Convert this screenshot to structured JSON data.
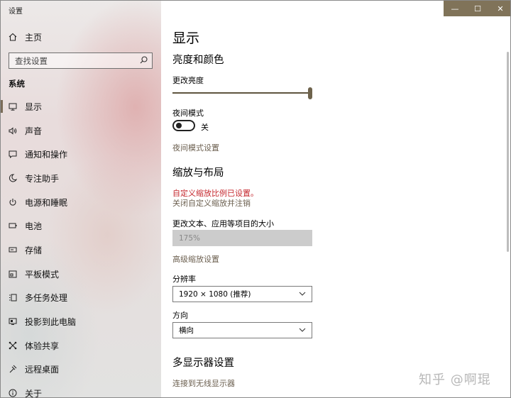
{
  "app_title": "设置",
  "window_controls": {
    "minimize": "—",
    "maximize": "☐",
    "close": "✕"
  },
  "sidebar": {
    "home": {
      "icon": "home-icon",
      "label": "主页"
    },
    "search": {
      "placeholder": "查找设置",
      "icon": "search-icon"
    },
    "section_label": "系统",
    "items": [
      {
        "icon": "monitor-icon",
        "label": "显示",
        "active": true
      },
      {
        "icon": "speaker-icon",
        "label": "声音"
      },
      {
        "icon": "notification-icon",
        "label": "通知和操作"
      },
      {
        "icon": "focus-assist-icon",
        "label": "专注助手"
      },
      {
        "icon": "power-icon",
        "label": "电源和睡眠"
      },
      {
        "icon": "battery-icon",
        "label": "电池"
      },
      {
        "icon": "storage-icon",
        "label": "存储"
      },
      {
        "icon": "tablet-icon",
        "label": "平板模式"
      },
      {
        "icon": "multitasking-icon",
        "label": "多任务处理"
      },
      {
        "icon": "project-icon",
        "label": "投影到此电脑"
      },
      {
        "icon": "shared-experiences-icon",
        "label": "体验共享"
      },
      {
        "icon": "remote-desktop-icon",
        "label": "远程桌面"
      },
      {
        "icon": "info-icon",
        "label": "关于"
      }
    ]
  },
  "main": {
    "page_title": "显示",
    "brightness_section": "亮度和颜色",
    "brightness_label": "更改亮度",
    "brightness_level": 1.0,
    "night_light_label": "夜间模式",
    "night_light_state": "关",
    "night_light_settings_link": "夜间模式设置",
    "scale_section": "缩放与布局",
    "custom_scale_warning": "自定义缩放比例已设置。",
    "custom_scale_link": "关闭自定义缩放并注销",
    "text_size_label": "更改文本、应用等项目的大小",
    "text_size_value": "175%",
    "advanced_scaling_link": "高级缩放设置",
    "resolution_label": "分辨率",
    "resolution_value": "1920 × 1080 (推荐)",
    "orientation_label": "方向",
    "orientation_value": "横向",
    "multi_display_section": "多显示器设置",
    "wireless_display_link": "连接到无线显示器"
  },
  "watermark": "知乎 @啊琨",
  "colors": {
    "accent": "#807359",
    "link": "#6c6050",
    "warning": "#c5282e"
  }
}
